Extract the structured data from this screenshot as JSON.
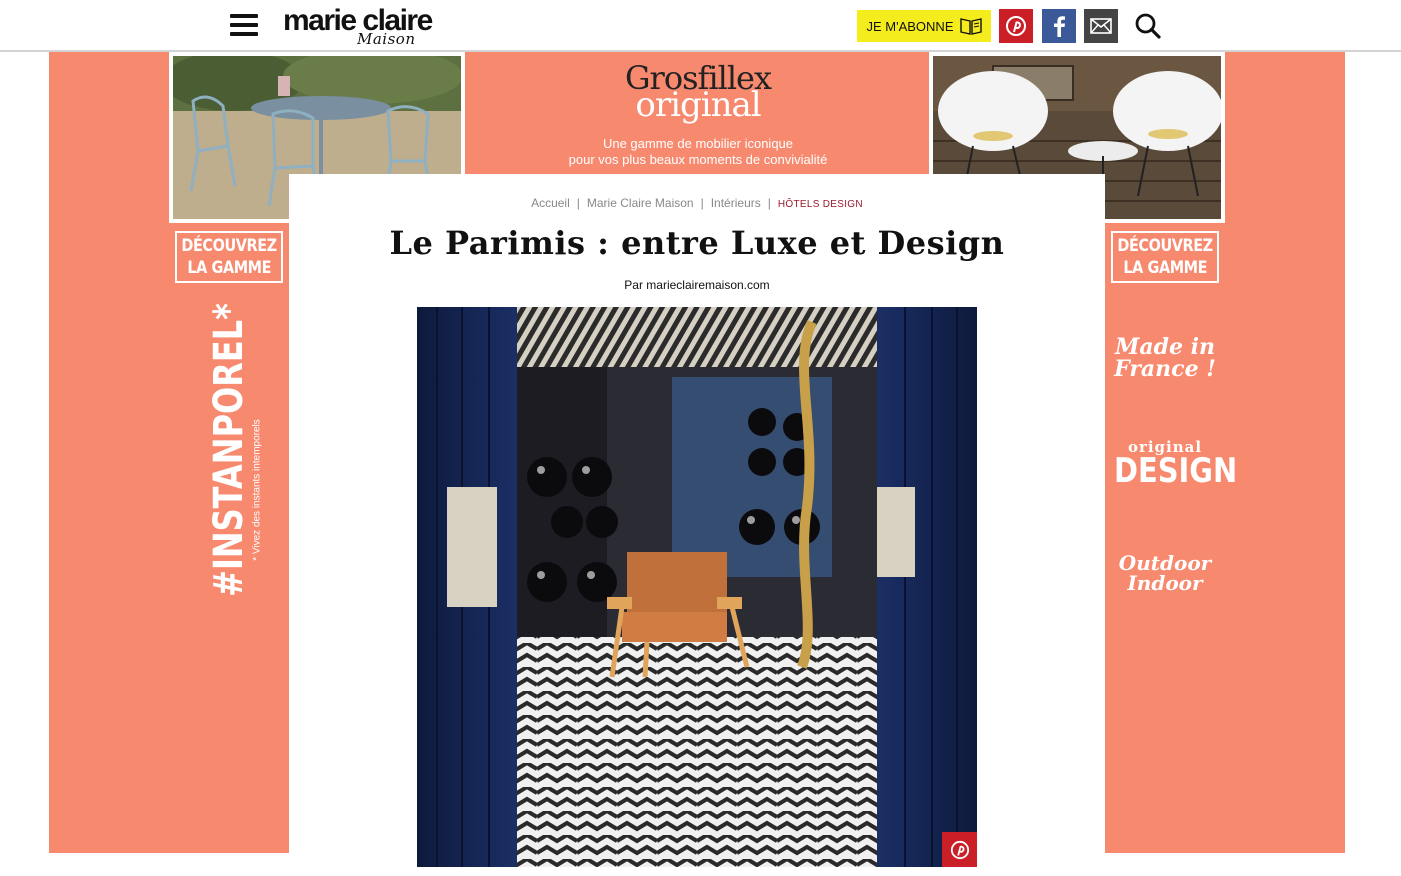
{
  "header": {
    "logo_main": "marie claire",
    "logo_sub": "Maison",
    "subscribe_label": "JE M'ABONNE",
    "icons": [
      "menu-icon",
      "book-icon",
      "pinterest-icon",
      "facebook-icon",
      "mail-icon",
      "search-icon"
    ]
  },
  "ad": {
    "brand_line1": "Grosfillex",
    "brand_line2": "original",
    "tagline_line1": "Une gamme de mobilier iconique",
    "tagline_line2": "pour vos plus beaux moments de convivialité",
    "cta_left_line1": "DÉCOUVREZ",
    "cta_left_line2": "LA GAMME",
    "cta_right_line1": "DÉCOUVREZ",
    "cta_right_line2": "LA GAMME",
    "hashtag": "#INSTANPOREL*",
    "hashtag_note": "* Vivez des instants intemporels",
    "claim1_line1": "Made in",
    "claim1_line2": "France !",
    "claim2_line1": "original",
    "claim2_line2": "DESIGN",
    "claim3_line1": "Outdoor",
    "claim3_line2": "Indoor",
    "colors": {
      "salmon": "#f7896f",
      "yellow": "#f5ec1e",
      "pinterest": "#cb1f27",
      "facebook": "#3b5998"
    }
  },
  "article": {
    "breadcrumb": [
      {
        "label": "Accueil"
      },
      {
        "label": "Marie Claire Maison"
      },
      {
        "label": "Intérieurs"
      },
      {
        "label": "HÔTELS DESIGN"
      }
    ],
    "title": "Le Parimis : entre Luxe et Design",
    "byline": "Par marieclairemaison.com",
    "hero_icon": "pinterest-icon"
  }
}
